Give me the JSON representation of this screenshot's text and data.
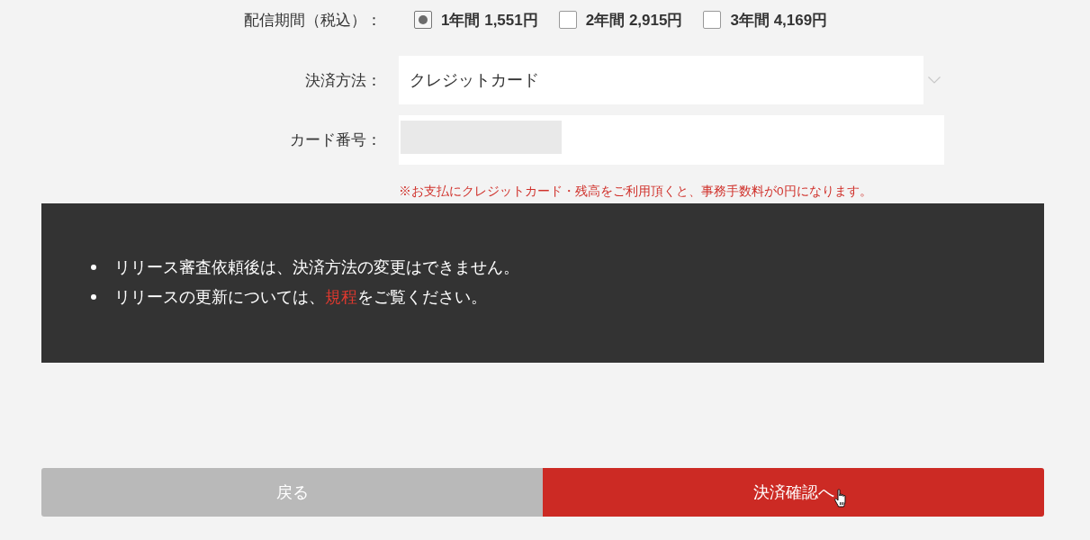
{
  "delivery_period": {
    "label": "配信期間（税込）：",
    "options": [
      {
        "label": "1年間 1,551円",
        "selected": true
      },
      {
        "label": "2年間 2,915円",
        "selected": false
      },
      {
        "label": "3年間 4,169円",
        "selected": false
      }
    ]
  },
  "payment_method": {
    "label": "決済方法：",
    "value": "クレジットカード"
  },
  "card_number": {
    "label": "カード番号："
  },
  "fee_note": "※お支払にクレジットカード・残高をご利用頂くと、事務手数料が0円になります。",
  "notices": [
    {
      "segments": [
        {
          "kind": "text",
          "text": "リリース審査依頼後は、決済方法の変更はできません。"
        }
      ]
    },
    {
      "segments": [
        {
          "kind": "text",
          "text": "リリースの更新については、"
        },
        {
          "kind": "link",
          "text": "規程"
        },
        {
          "kind": "text",
          "text": "をご覧ください。"
        }
      ]
    }
  ],
  "buttons": [
    {
      "kind": "secondary",
      "label": "戻る"
    },
    {
      "kind": "primary",
      "label": "決済確認へ"
    }
  ]
}
